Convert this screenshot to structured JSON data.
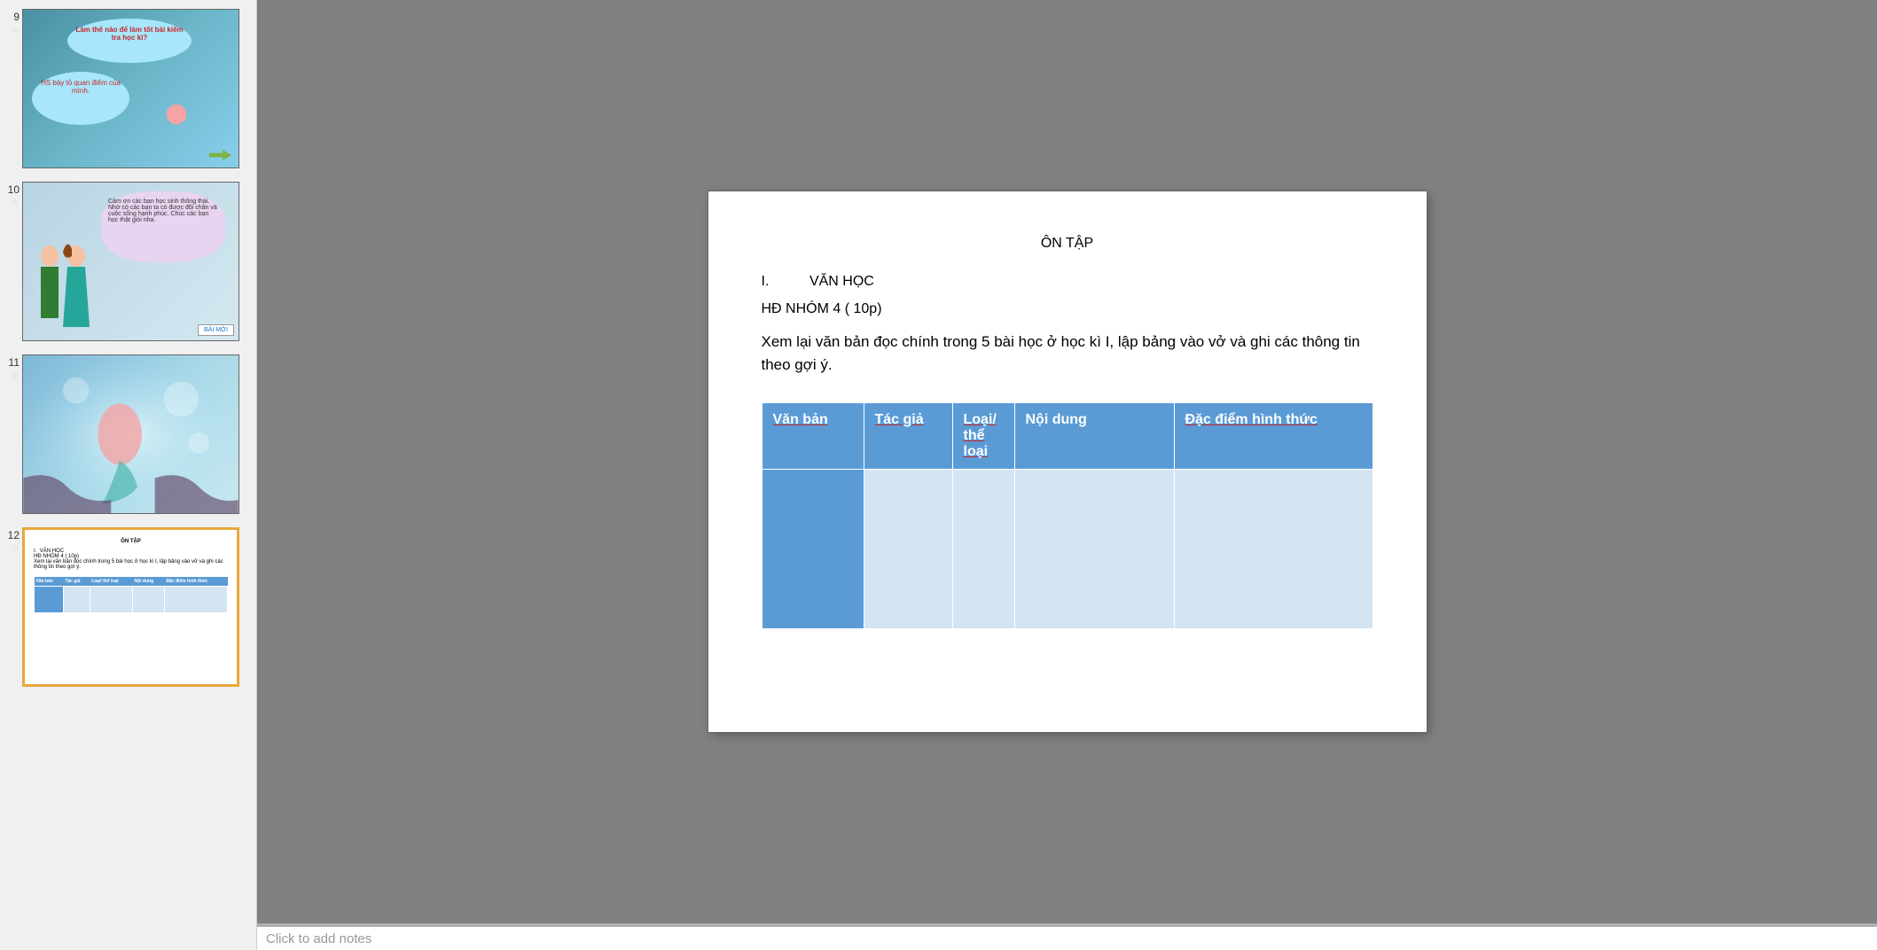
{
  "thumbnails": [
    {
      "number": "9",
      "cloud1_text": "Làm thế nào để làm tốt bài kiểm tra học kì?",
      "cloud2_text": "HS bày tỏ quan điểm của mình."
    },
    {
      "number": "10",
      "cloud_text": "Cảm ơn các bạn học sinh thông thái. Nhờ có các bạn ta có được đôi chân và cuộc sống hạnh phúc. Chúc các bạn học thật giỏi nha.",
      "button": "BÀI MỚI"
    },
    {
      "number": "11"
    },
    {
      "number": "12",
      "title": "ÔN TẬP",
      "section": "I.",
      "section_label": "VĂN HỌC",
      "subtitle": "HĐ NHÓM 4 ( 10p)",
      "text": "Xem lại văn bản đọc chính trong 5 bài học ở học kì I, lập bảng vào vở và ghi các thông tin  theo gợi ý."
    }
  ],
  "current_slide": {
    "title": "ÔN TẬP",
    "section_number": "I.",
    "section_label": "VĂN HỌC",
    "subtitle": "HĐ NHÓM 4 ( 10p)",
    "body_text": "Xem lại văn bản đọc chính trong 5 bài học ở học kì I, lập bảng vào vở và ghi các thông tin  theo gợi ý.",
    "table": {
      "headers": [
        "Văn bản",
        "Tác giả",
        "Loại/ thể loại",
        "Nội dung",
        "Đặc điểm hình thức"
      ]
    }
  },
  "notes": {
    "placeholder": "Click to add notes"
  }
}
